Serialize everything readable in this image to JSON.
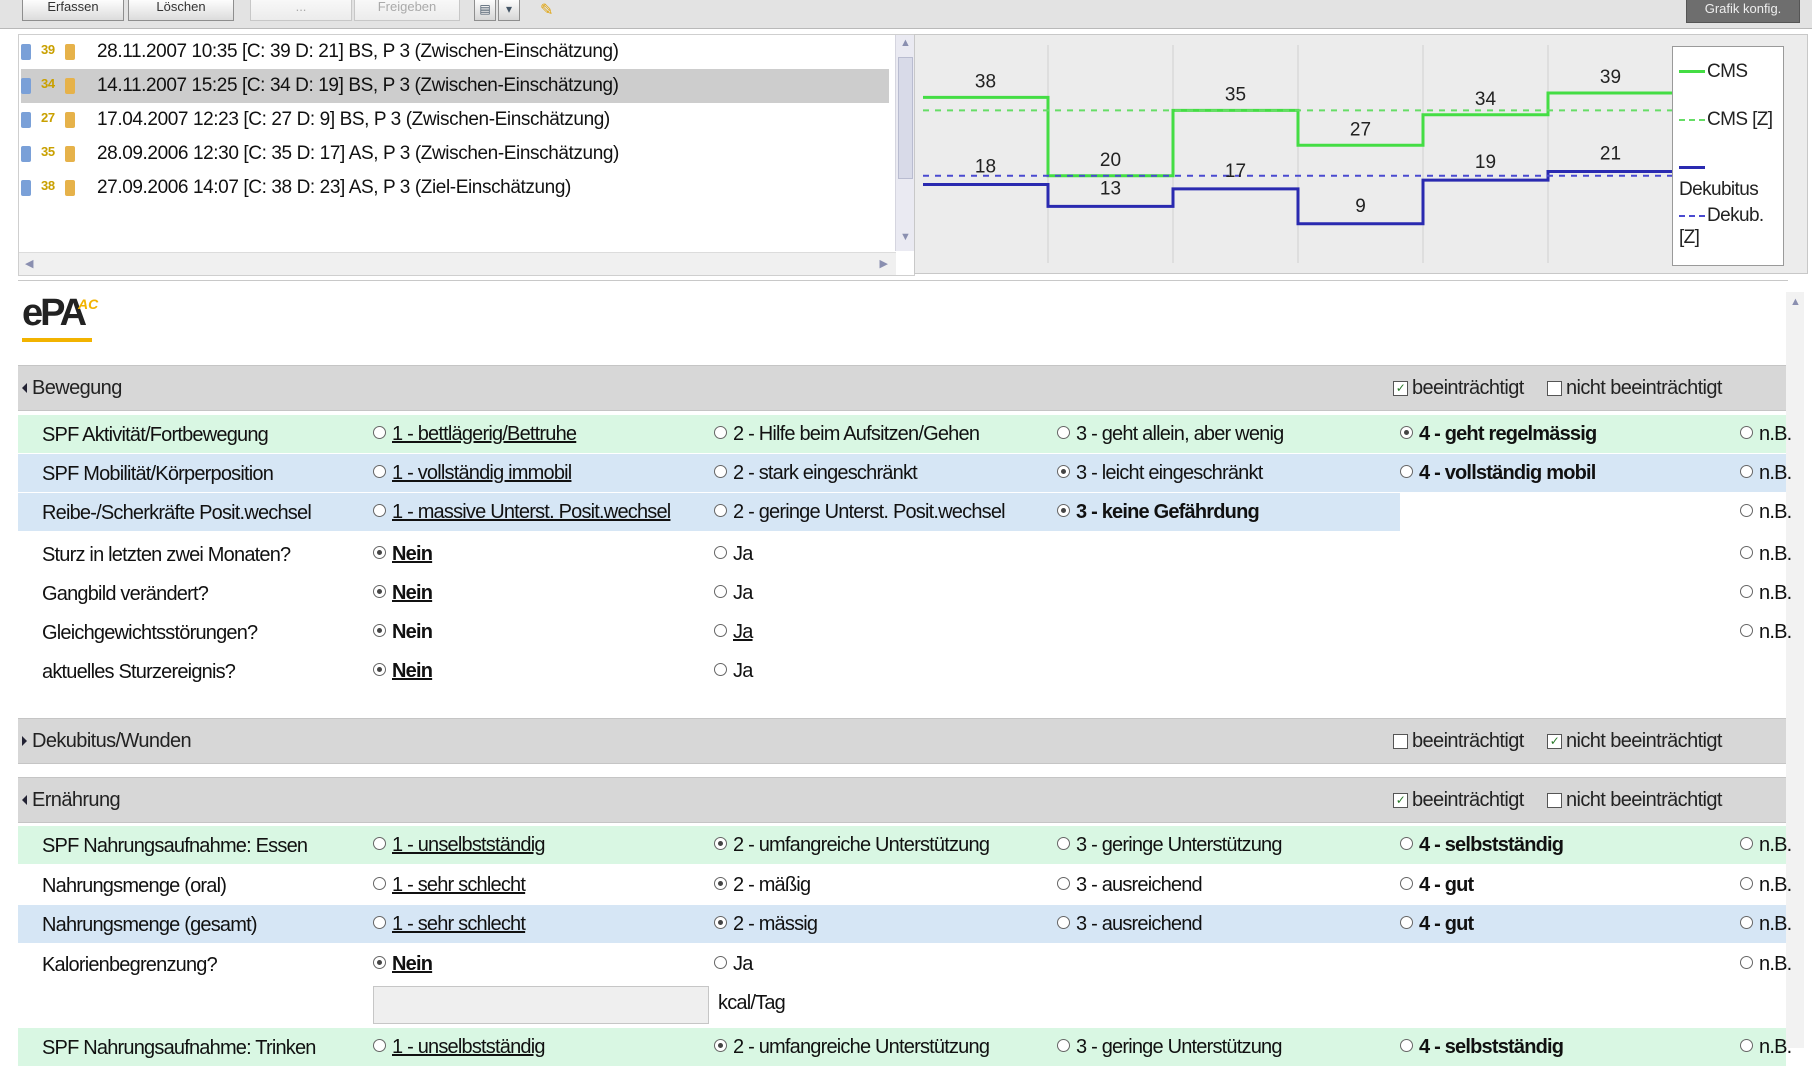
{
  "toolbar": {
    "buttons": [
      {
        "label": "Erfassen",
        "enabled": true
      },
      {
        "label": "Löschen",
        "enabled": true
      },
      {
        "label": "...",
        "enabled": false
      },
      {
        "label": "Freigeben",
        "enabled": false
      }
    ],
    "right_button": "Grafik konfig."
  },
  "assessments": [
    {
      "text": "28.11.2007 10:35 [C: 39 D: 21] BS, P 3 (Zwischen-Einschätzung)",
      "badge": "39",
      "selected": false
    },
    {
      "text": "14.11.2007 15:25 [C: 34 D: 19] BS, P 3 (Zwischen-Einschätzung)",
      "badge": "34",
      "selected": true
    },
    {
      "text": "17.04.2007 12:23 [C: 27 D: 9] BS, P 3 (Zwischen-Einschätzung)",
      "badge": "27",
      "selected": false
    },
    {
      "text": "28.09.2006 12:30 [C: 35 D: 17] AS, P 3 (Zwischen-Einschätzung)",
      "badge": "35",
      "selected": false
    },
    {
      "text": "27.09.2006 14:07 [C: 38 D: 23] AS, P 3 (Ziel-Einschätzung)",
      "badge": "38",
      "selected": false
    }
  ],
  "chart_data": {
    "type": "line",
    "step": true,
    "series": [
      {
        "name": "CMS",
        "style": "solid",
        "color": "#44dd44",
        "values": [
          38,
          20,
          35,
          27,
          34,
          39
        ]
      },
      {
        "name": "CMS [Z]",
        "style": "dashed",
        "color": "#66dd66",
        "values": [
          35,
          35,
          35,
          35,
          35,
          35
        ]
      },
      {
        "name": "Dekubitus",
        "style": "solid",
        "color": "#2a2ab0",
        "values": [
          18,
          13,
          17,
          9,
          19,
          21
        ]
      },
      {
        "name": "Dekub. [Z]",
        "style": "dashed",
        "color": "#4a4ad0",
        "values": [
          20,
          20,
          20,
          20,
          20,
          20
        ]
      }
    ],
    "cms_labels": [
      "38",
      "20",
      "35",
      "27",
      "34",
      "39"
    ],
    "dekub_labels": [
      "18",
      "13",
      "17",
      "9",
      "19",
      "21"
    ],
    "ylim": [
      0,
      50
    ],
    "grid": true,
    "legend_position": "right"
  },
  "logo": {
    "text": "ePA",
    "superscript": "AC"
  },
  "sections": {
    "bewegung": {
      "title": "Bewegung",
      "impaired": "beeinträchtigt",
      "not_impaired": "nicht beeinträchtigt",
      "impaired_checked": true,
      "not_impaired_checked": false,
      "rows": [
        {
          "label": "SPF Aktivität/Fortbewegung",
          "bg": "green",
          "opts": [
            {
              "text": "1 - bettlägerig/Bettruhe",
              "style": "u",
              "on": false
            },
            {
              "text": "2 - Hilfe beim Aufsitzen/Gehen",
              "style": "",
              "on": false
            },
            {
              "text": "3 - geht allein, aber wenig",
              "style": "",
              "on": false
            },
            {
              "text": "4 - geht regelmässig",
              "style": "b",
              "on": true
            },
            {
              "text": "n.B.",
              "style": "",
              "on": false
            }
          ]
        },
        {
          "label": "SPF Mobilität/Körperposition",
          "bg": "blue",
          "opts": [
            {
              "text": "1 - vollständig immobil",
              "style": "u",
              "on": false
            },
            {
              "text": "2 - stark eingeschränkt",
              "style": "",
              "on": false
            },
            {
              "text": "3 - leicht eingeschränkt",
              "style": "",
              "on": true
            },
            {
              "text": "4 - vollständig mobil",
              "style": "b",
              "on": false
            },
            {
              "text": "n.B.",
              "style": "",
              "on": false
            }
          ]
        },
        {
          "label": "Reibe-/Scherkräfte Posit.wechsel",
          "bg": "blue",
          "short": true,
          "opts": [
            {
              "text": "1 - massive Unterst. Posit.wechsel",
              "style": "u",
              "on": false
            },
            {
              "text": "2 - geringe Unterst. Posit.wechsel",
              "style": "",
              "on": false
            },
            {
              "text": "3 - keine Gefährdung",
              "style": "b",
              "on": true
            },
            {
              "text": "",
              "style": "",
              "on": false
            },
            {
              "text": "n.B.",
              "style": "",
              "on": false
            }
          ]
        },
        {
          "label": "Sturz in letzten zwei Monaten?",
          "bg": "",
          "opts": [
            {
              "text": "Nein",
              "style": "ub",
              "on": true
            },
            {
              "text": "Ja",
              "style": "",
              "on": false
            },
            {
              "text": "",
              "style": "",
              "on": false
            },
            {
              "text": "",
              "style": "",
              "on": false
            },
            {
              "text": "n.B.",
              "style": "",
              "on": false
            }
          ]
        },
        {
          "label": "Gangbild verändert?",
          "bg": "",
          "opts": [
            {
              "text": "Nein",
              "style": "ub",
              "on": true
            },
            {
              "text": "Ja",
              "style": "",
              "on": false
            },
            {
              "text": "",
              "style": "",
              "on": false
            },
            {
              "text": "",
              "style": "",
              "on": false
            },
            {
              "text": "n.B.",
              "style": "",
              "on": false
            }
          ]
        },
        {
          "label": "Gleichgewichtsstörungen?",
          "bg": "",
          "opts": [
            {
              "text": "Nein",
              "style": "b",
              "on": true
            },
            {
              "text": "Ja",
              "style": "u",
              "on": false
            },
            {
              "text": "",
              "style": "",
              "on": false
            },
            {
              "text": "",
              "style": "",
              "on": false
            },
            {
              "text": "n.B.",
              "style": "",
              "on": false
            }
          ]
        },
        {
          "label": "aktuelles Sturzereignis?",
          "bg": "",
          "opts": [
            {
              "text": "Nein",
              "style": "ub",
              "on": true
            },
            {
              "text": "Ja",
              "style": "",
              "on": false
            },
            {
              "text": "",
              "style": "",
              "on": false
            },
            {
              "text": "",
              "style": "",
              "on": false
            },
            {
              "text": "",
              "style": "",
              "on": false
            }
          ]
        }
      ]
    },
    "dekubitus": {
      "title": "Dekubitus/Wunden",
      "impaired": "beeinträchtigt",
      "not_impaired": "nicht beeinträchtigt",
      "impaired_checked": false,
      "not_impaired_checked": true
    },
    "ernaehrung": {
      "title": "Ernährung",
      "impaired": "beeinträchtigt",
      "not_impaired": "nicht beeinträchtigt",
      "impaired_checked": true,
      "not_impaired_checked": false,
      "rows": [
        {
          "label": "SPF Nahrungsaufnahme: Essen",
          "bg": "green",
          "opts": [
            {
              "text": "1 - unselbstständig",
              "style": "u",
              "on": false
            },
            {
              "text": "2 - umfangreiche Unterstützung",
              "style": "",
              "on": true
            },
            {
              "text": "3 - geringe Unterstützung",
              "style": "",
              "on": false
            },
            {
              "text": "4 - selbstständig",
              "style": "b",
              "on": false
            },
            {
              "text": "n.B.",
              "style": "",
              "on": false
            }
          ]
        },
        {
          "label": "Nahrungsmenge (oral)",
          "bg": "",
          "opts": [
            {
              "text": "1 - sehr schlecht",
              "style": "u",
              "on": false
            },
            {
              "text": "2 - mäßig",
              "style": "",
              "on": true
            },
            {
              "text": "3 - ausreichend",
              "style": "",
              "on": false
            },
            {
              "text": "4 - gut",
              "style": "b",
              "on": false
            },
            {
              "text": "n.B.",
              "style": "",
              "on": false
            }
          ]
        },
        {
          "label": "Nahrungsmenge (gesamt)",
          "bg": "blue",
          "opts": [
            {
              "text": "1 - sehr schlecht",
              "style": "u",
              "on": false
            },
            {
              "text": "2 - mässig",
              "style": "",
              "on": true
            },
            {
              "text": "3 - ausreichend",
              "style": "",
              "on": false
            },
            {
              "text": "4 - gut",
              "style": "b",
              "on": false
            },
            {
              "text": "n.B.",
              "style": "",
              "on": false
            }
          ]
        },
        {
          "label": "Kalorienbegrenzung?",
          "bg": "",
          "opts": [
            {
              "text": "Nein",
              "style": "ub",
              "on": true
            },
            {
              "text": "Ja",
              "style": "",
              "on": false
            },
            {
              "text": "",
              "style": "",
              "on": false
            },
            {
              "text": "",
              "style": "",
              "on": false
            },
            {
              "text": "n.B.",
              "style": "",
              "on": false
            }
          ]
        }
      ],
      "calorie_unit": "kcal/Tag",
      "next_row": {
        "label": "SPF Nahrungsaufnahme: Trinken",
        "opts": [
          {
            "text": "1 - unselbstständig",
            "style": "u",
            "on": false
          },
          {
            "text": "2 - umfangreiche Unterstützung",
            "style": "",
            "on": true
          },
          {
            "text": "3 - geringe Unterstützung",
            "style": "",
            "on": false
          },
          {
            "text": "4 - selbstständig",
            "style": "b",
            "on": false
          },
          {
            "text": "n.B.",
            "style": "",
            "on": false
          }
        ]
      }
    }
  }
}
